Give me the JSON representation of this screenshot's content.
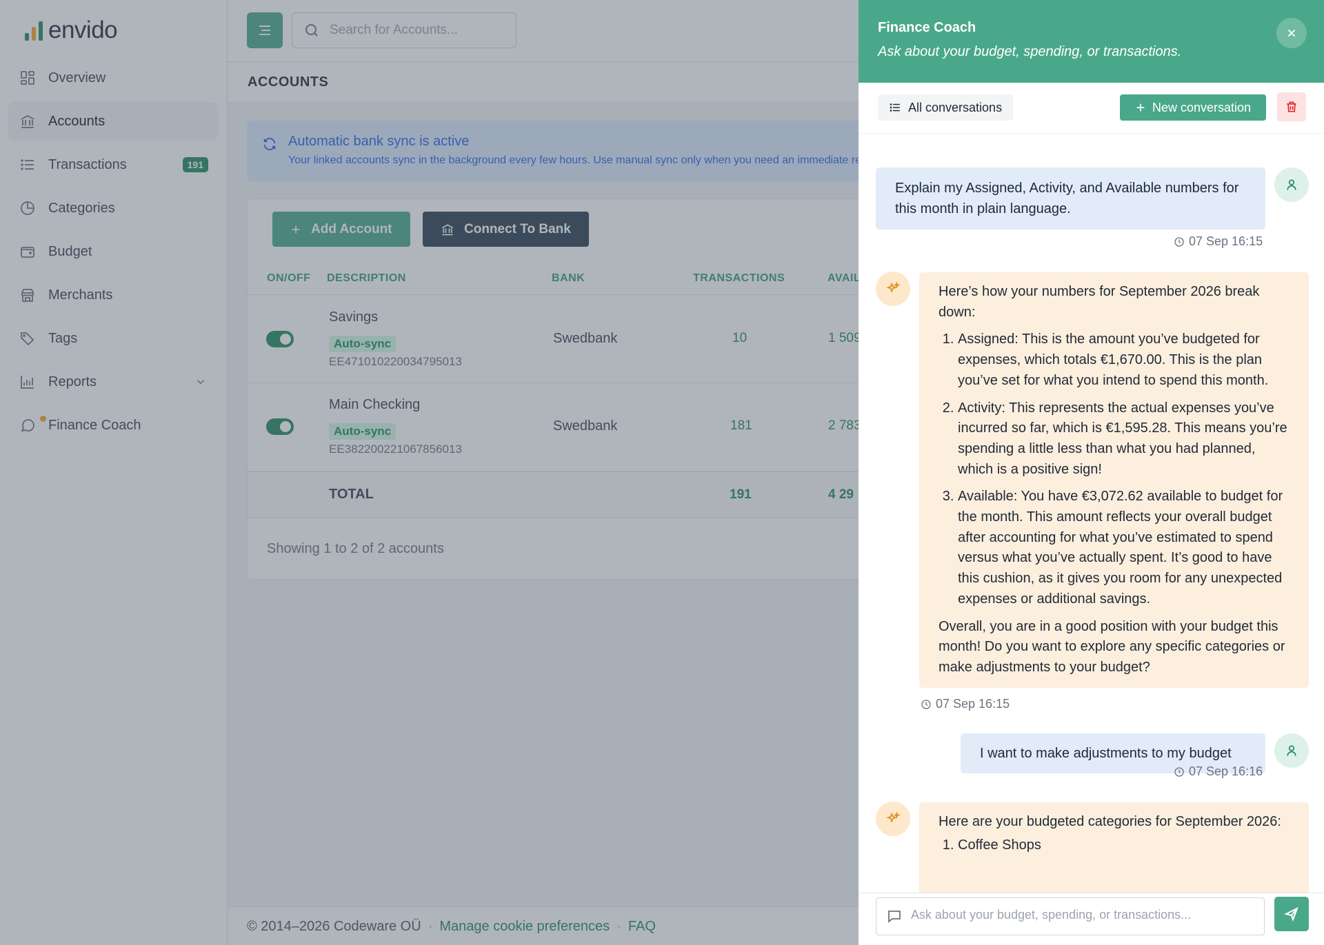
{
  "app": {
    "logo_text": "envido",
    "brand_color": "#4aa88a",
    "search_placeholder": "Search for Accounts..."
  },
  "sidebar": {
    "items": [
      {
        "label": "Overview",
        "icon": "grid-icon"
      },
      {
        "label": "Accounts",
        "icon": "bank-icon",
        "active": true
      },
      {
        "label": "Transactions",
        "icon": "list-icon",
        "badge": "191"
      },
      {
        "label": "Categories",
        "icon": "pie-chart-icon"
      },
      {
        "label": "Budget",
        "icon": "wallet-icon"
      },
      {
        "label": "Merchants",
        "icon": "store-icon"
      },
      {
        "label": "Tags",
        "icon": "tags-icon"
      },
      {
        "label": "Reports",
        "icon": "bar-chart-icon",
        "has_submenu": true
      },
      {
        "label": "Finance Coach",
        "icon": "chat-icon"
      }
    ]
  },
  "page": {
    "title": "ACCOUNTS"
  },
  "sync_alert": {
    "title": "Automatic bank sync is active",
    "description": "Your linked accounts sync in the background every few hours. Use manual sync only when you need an immediate re"
  },
  "actions": {
    "add_account": "Add Account",
    "connect_bank": "Connect To Bank"
  },
  "table": {
    "headers": {
      "onoff": "ON/OFF",
      "description": "DESCRIPTION",
      "bank": "BANK",
      "transactions": "TRANSACTIONS",
      "available": "AVAIL"
    },
    "rows": [
      {
        "name": "Savings",
        "badge": "Auto-sync",
        "iban": "EE471010220034795013",
        "bank": "Swedbank",
        "transactions": "10",
        "available": "1 509",
        "enabled": true
      },
      {
        "name": "Main Checking",
        "badge": "Auto-sync",
        "iban": "EE382200221067856013",
        "bank": "Swedbank",
        "transactions": "181",
        "available": "2 783",
        "enabled": true
      }
    ],
    "total": {
      "label": "TOTAL",
      "transactions": "191",
      "available": "4 29"
    },
    "showing": "Showing 1 to 2 of 2 accounts"
  },
  "footer": {
    "copyright": "© 2014–2026 Codeware OÜ",
    "sep": "·",
    "cookie_link": "Manage cookie preferences",
    "faq_link": "FAQ"
  },
  "coach": {
    "title": "Finance Coach",
    "subtitle": "Ask about your budget, spending, or transactions.",
    "all_conversations": "All conversations",
    "new_conversation": "New conversation",
    "input_placeholder": "Ask about your budget, spending, or transactions...",
    "messages": [
      {
        "role": "user",
        "text": "Explain my Assigned, Activity, and Available numbers for this month in plain language.",
        "time": "07 Sep 16:15"
      },
      {
        "role": "assistant",
        "intro": "Here’s how your numbers for September 2026 break down:",
        "items": [
          "Assigned: This is the amount you’ve budgeted for expenses, which totals €1,670.00. This is the plan you’ve set for what you intend to spend this month.",
          "Activity: This represents the actual expenses you’ve incurred so far, which is €1,595.28. This means you’re spending a little less than what you had planned, which is a positive sign!",
          "Available: You have €3,072.62 available to budget for the month. This amount reflects your overall budget after accounting for what you’ve estimated to spend versus what you’ve actually spent. It’s good to have this cushion, as it gives you room for any unexpected expenses or additional savings."
        ],
        "outro": "Overall, you are in a good position with your budget this month! Do you want to explore any specific categories or make adjustments to your budget?",
        "time": "07 Sep 16:15"
      },
      {
        "role": "user",
        "text": "I want to make adjustments to my budget",
        "time": "07 Sep 16:16"
      },
      {
        "role": "assistant",
        "intro": "Here are your budgeted categories for September 2026:",
        "items": [
          "Coffee Shops"
        ]
      }
    ]
  }
}
